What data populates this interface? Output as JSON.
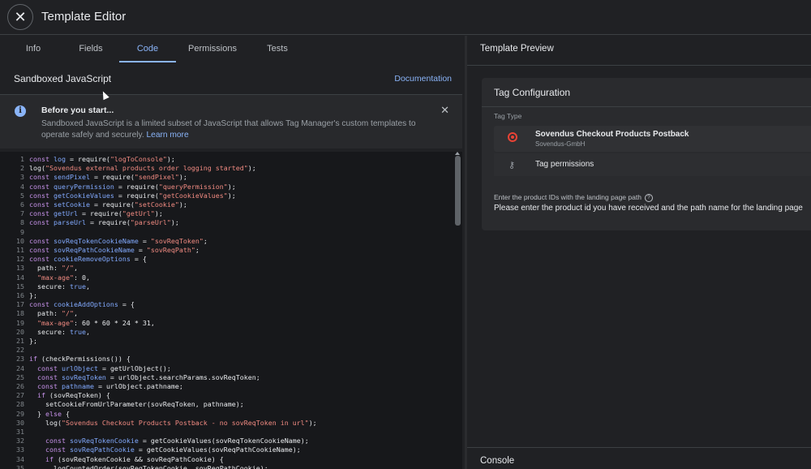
{
  "window": {
    "title": "Template Editor"
  },
  "tabs": [
    {
      "label": "Info",
      "active": false
    },
    {
      "label": "Fields",
      "active": false
    },
    {
      "label": "Code",
      "active": true
    },
    {
      "label": "Permissions",
      "active": false
    },
    {
      "label": "Tests",
      "active": false
    }
  ],
  "editor": {
    "section_title": "Sandboxed JavaScript",
    "documentation_link": "Documentation",
    "notice": {
      "title": "Before you start...",
      "body": "Sandboxed JavaScript is a limited subset of JavaScript that allows Tag Manager's custom templates to operate safely and securely.",
      "link": "Learn more"
    },
    "code_lines": [
      "const log = require(\"logToConsole\");",
      "log(\"Sovendus external products order logging started\");",
      "const sendPixel = require(\"sendPixel\");",
      "const queryPermission = require(\"queryPermission\");",
      "const getCookieValues = require(\"getCookieValues\");",
      "const setCookie = require(\"setCookie\");",
      "const getUrl = require(\"getUrl\");",
      "const parseUrl = require(\"parseUrl\");",
      "",
      "const sovReqTokenCookieName = \"sovReqToken\";",
      "const sovReqPathCookieName = \"sovReqPath\";",
      "const cookieRemoveOptions = {",
      "  path: \"/\",",
      "  \"max-age\": 0,",
      "  secure: true,",
      "};",
      "const cookieAddOptions = {",
      "  path: \"/\",",
      "  \"max-age\": 60 * 60 * 24 * 31,",
      "  secure: true,",
      "};",
      "",
      "if (checkPermissions()) {",
      "  const urlObject = getUrlObject();",
      "  const sovReqToken = urlObject.searchParams.sovReqToken;",
      "  const pathname = urlObject.pathname;",
      "  if (sovReqToken) {",
      "    setCookieFromUrlParameter(sovReqToken, pathname);",
      "  } else {",
      "    log(\"Sovendus Checkout Products Postback - no sovReqToken in url\");",
      "",
      "    const sovReqTokenCookie = getCookieValues(sovReqTokenCookieName);",
      "    const sovReqPathCookie = getCookieValues(sovReqPathCookieName);",
      "    if (sovReqTokenCookie && sovReqPathCookie) {",
      "      logCountedOrder(sovReqTokenCookie, sovReqPathCookie);"
    ]
  },
  "preview": {
    "title": "Template Preview",
    "card_title": "Tag Configuration",
    "tag_type_label": "Tag Type",
    "tag_name": "Sovendus Checkout Products Postback",
    "tag_vendor": "Sovendus-GmbH",
    "permissions_label": "Tag permissions",
    "field_label": "Enter the product IDs with the landing page path",
    "field_help": "Please enter the product id you have received and the path name for the landing page",
    "console_title": "Console"
  },
  "icons": {
    "close": "close-icon",
    "info": "info-icon",
    "notice_close": "close-icon",
    "tag_logo": "sovendus-logo-icon",
    "key": "key-icon",
    "help": "help-icon"
  },
  "colors": {
    "accent": "#8ab4f8",
    "background": "#202124",
    "code_bg": "#17181b",
    "brand": "#ea4335"
  }
}
